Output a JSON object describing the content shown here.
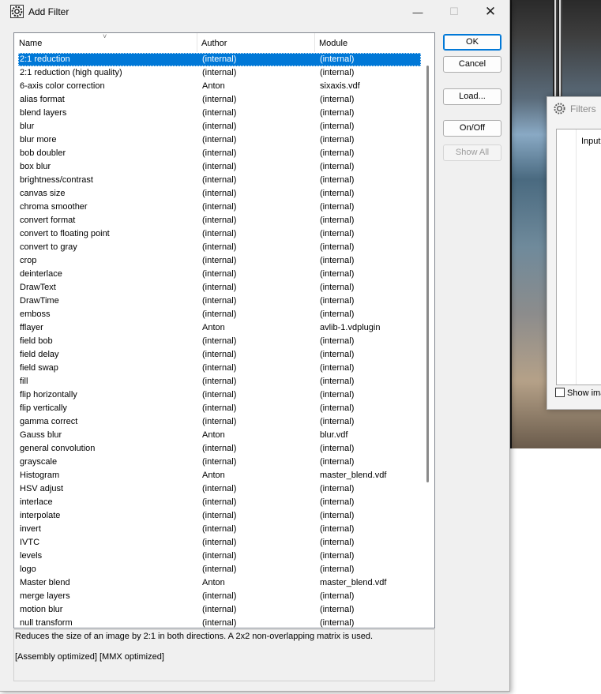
{
  "dialog": {
    "title": "Add Filter",
    "minimize_glyph": "—",
    "maximize_glyph": "☐",
    "close_glyph": "✕"
  },
  "list": {
    "columns": [
      "Name",
      "Author",
      "Module"
    ],
    "selected_index": 0,
    "rows": [
      [
        "2:1 reduction",
        "(internal)",
        "(internal)"
      ],
      [
        "2:1 reduction (high quality)",
        "(internal)",
        "(internal)"
      ],
      [
        "6-axis color correction",
        "Anton",
        "sixaxis.vdf"
      ],
      [
        "alias format",
        "(internal)",
        "(internal)"
      ],
      [
        "blend layers",
        "(internal)",
        "(internal)"
      ],
      [
        "blur",
        "(internal)",
        "(internal)"
      ],
      [
        "blur more",
        "(internal)",
        "(internal)"
      ],
      [
        "bob doubler",
        "(internal)",
        "(internal)"
      ],
      [
        "box blur",
        "(internal)",
        "(internal)"
      ],
      [
        "brightness/contrast",
        "(internal)",
        "(internal)"
      ],
      [
        "canvas size",
        "(internal)",
        "(internal)"
      ],
      [
        "chroma smoother",
        "(internal)",
        "(internal)"
      ],
      [
        "convert format",
        "(internal)",
        "(internal)"
      ],
      [
        "convert to floating point",
        "(internal)",
        "(internal)"
      ],
      [
        "convert to gray",
        "(internal)",
        "(internal)"
      ],
      [
        "crop",
        "(internal)",
        "(internal)"
      ],
      [
        "deinterlace",
        "(internal)",
        "(internal)"
      ],
      [
        "DrawText",
        "(internal)",
        "(internal)"
      ],
      [
        "DrawTime",
        "(internal)",
        "(internal)"
      ],
      [
        "emboss",
        "(internal)",
        "(internal)"
      ],
      [
        "fflayer",
        "Anton",
        "avlib-1.vdplugin"
      ],
      [
        "field bob",
        "(internal)",
        "(internal)"
      ],
      [
        "field delay",
        "(internal)",
        "(internal)"
      ],
      [
        "field swap",
        "(internal)",
        "(internal)"
      ],
      [
        "fill",
        "(internal)",
        "(internal)"
      ],
      [
        "flip horizontally",
        "(internal)",
        "(internal)"
      ],
      [
        "flip vertically",
        "(internal)",
        "(internal)"
      ],
      [
        "gamma correct",
        "(internal)",
        "(internal)"
      ],
      [
        "Gauss blur",
        "Anton",
        "blur.vdf"
      ],
      [
        "general convolution",
        "(internal)",
        "(internal)"
      ],
      [
        "grayscale",
        "(internal)",
        "(internal)"
      ],
      [
        "Histogram",
        "Anton",
        "master_blend.vdf"
      ],
      [
        "HSV adjust",
        "(internal)",
        "(internal)"
      ],
      [
        "interlace",
        "(internal)",
        "(internal)"
      ],
      [
        "interpolate",
        "(internal)",
        "(internal)"
      ],
      [
        "invert",
        "(internal)",
        "(internal)"
      ],
      [
        "IVTC",
        "(internal)",
        "(internal)"
      ],
      [
        "levels",
        "(internal)",
        "(internal)"
      ],
      [
        "logo",
        "(internal)",
        "(internal)"
      ],
      [
        "Master blend",
        "Anton",
        "master_blend.vdf"
      ],
      [
        "merge layers",
        "(internal)",
        "(internal)"
      ],
      [
        "motion blur",
        "(internal)",
        "(internal)"
      ],
      [
        "null transform",
        "(internal)",
        "(internal)"
      ]
    ]
  },
  "description": {
    "line1": "Reduces the size of an image by 2:1 in both directions. A 2x2 non-overlapping matrix is used.",
    "line2": "[Assembly optimized] [MMX optimized]"
  },
  "buttons": {
    "ok": "OK",
    "cancel": "Cancel",
    "load": "Load...",
    "onoff": "On/Off",
    "showall": "Show All"
  },
  "filters_window": {
    "title": "Filters",
    "column_input": "Input",
    "show_checkbox_label": "Show ima"
  },
  "colors": {
    "selection": "#0078d7",
    "dialog_bg": "#f0f0f0"
  }
}
